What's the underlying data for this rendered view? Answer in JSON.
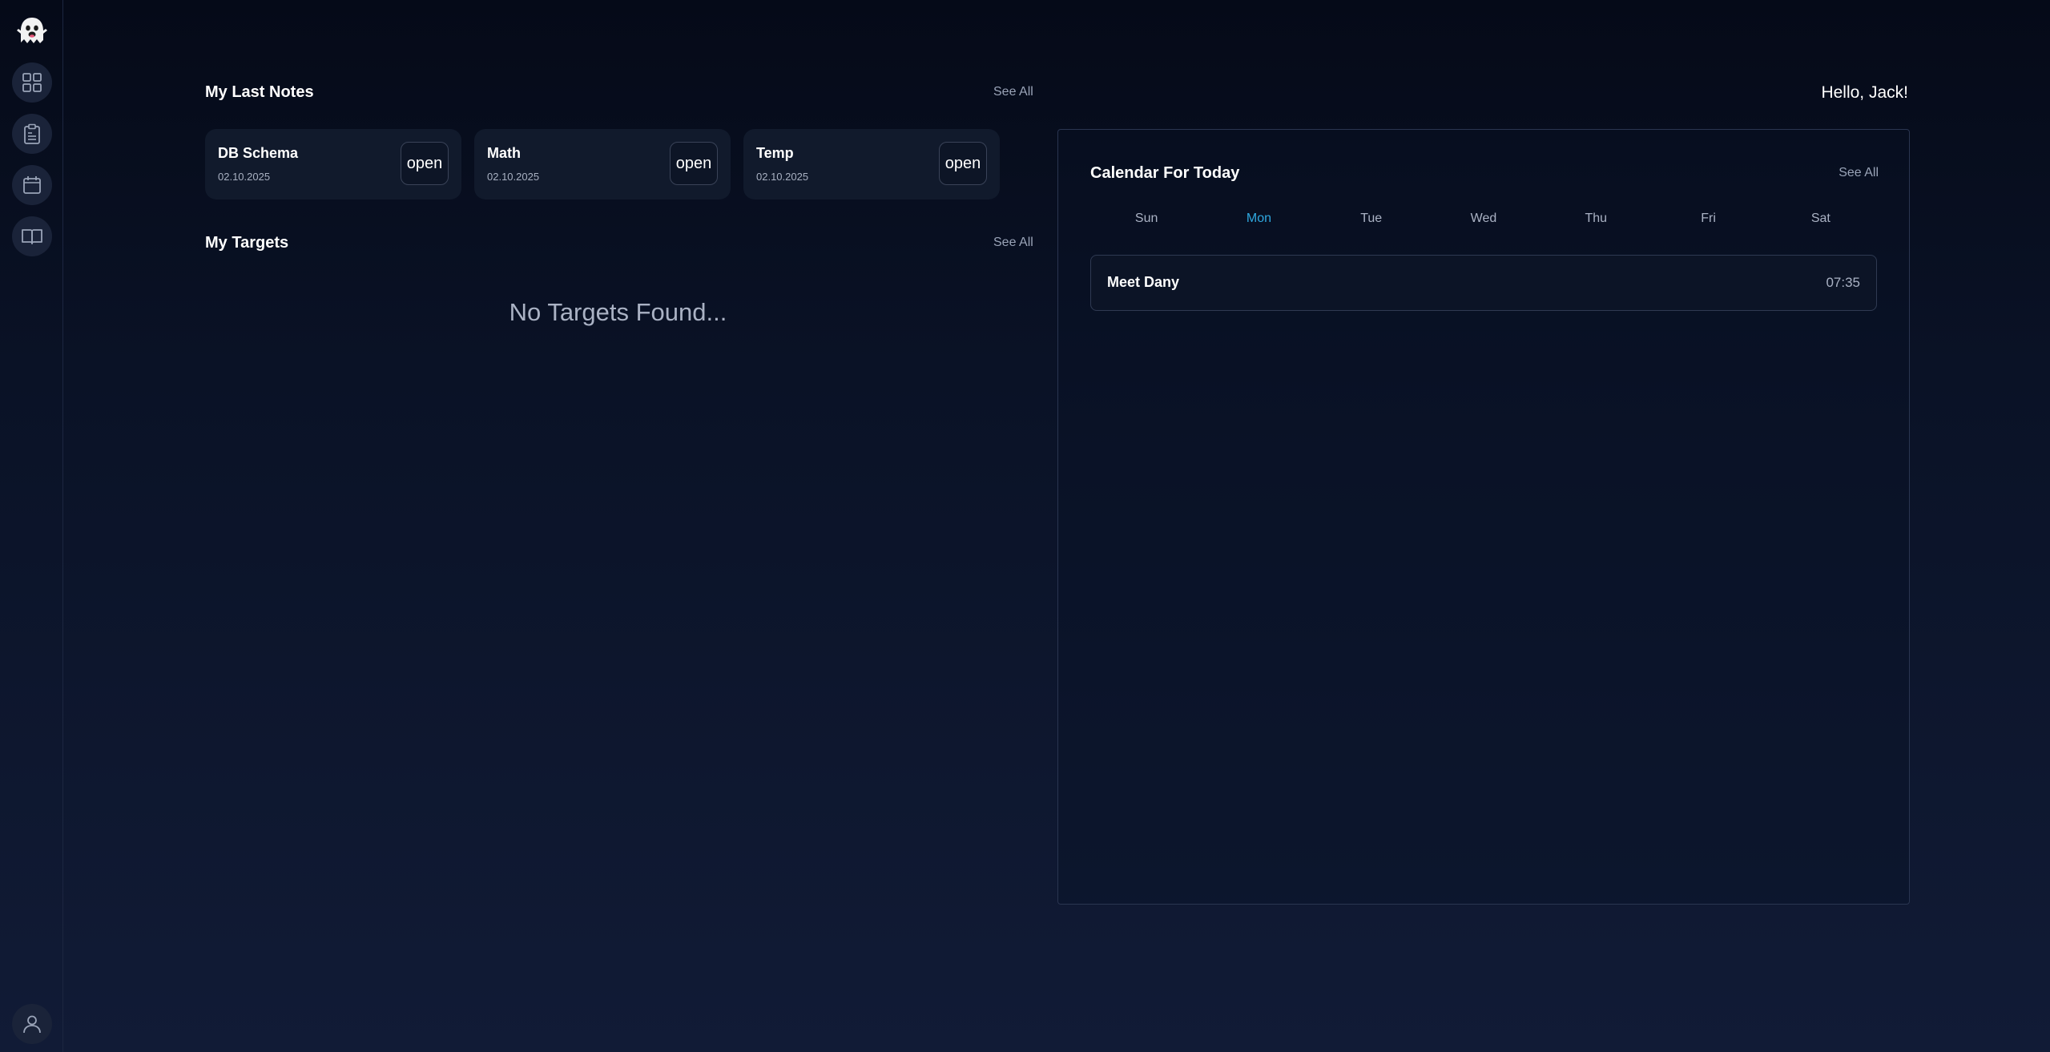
{
  "greeting": "Hello, Jack!",
  "sidebar": {
    "items": [
      {
        "name": "dashboard",
        "icon": "grid-icon"
      },
      {
        "name": "notes",
        "icon": "clipboard-icon"
      },
      {
        "name": "calendar",
        "icon": "calendar-icon"
      },
      {
        "name": "library",
        "icon": "book-icon"
      }
    ],
    "profile_icon": "user-icon",
    "logo_icon": "ghost-icon"
  },
  "notes": {
    "title": "My Last Notes",
    "see_all": "See All",
    "items": [
      {
        "title": "DB Schema",
        "date": "02.10.2025",
        "action": "open"
      },
      {
        "title": "Math",
        "date": "02.10.2025",
        "action": "open"
      },
      {
        "title": "Temp",
        "date": "02.10.2025",
        "action": "open"
      }
    ]
  },
  "targets": {
    "title": "My Targets",
    "see_all": "See All",
    "empty_message": "No Targets Found..."
  },
  "calendar": {
    "title": "Calendar For Today",
    "see_all": "See All",
    "weekdays": [
      "Sun",
      "Mon",
      "Tue",
      "Wed",
      "Thu",
      "Fri",
      "Sat"
    ],
    "active_day": "Mon",
    "events": [
      {
        "name": "Meet Dany",
        "time": "07:35"
      }
    ]
  },
  "colors": {
    "accent": "#2fa8e0",
    "background_top": "#050a18",
    "background_bottom": "#111b36",
    "card": "#111a2c"
  }
}
